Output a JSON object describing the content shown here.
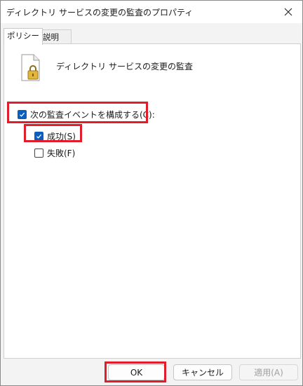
{
  "window": {
    "title": "ディレクトリ サービスの変更の監査のプロパティ",
    "close_icon": "close-icon"
  },
  "tabs": [
    {
      "label": "ポリシー",
      "active": true
    },
    {
      "label": "説明",
      "active": false
    }
  ],
  "policy": {
    "icon": "document-lock-icon",
    "name": "ディレクトリ サービスの変更の監査"
  },
  "options": {
    "configure": {
      "label": "次の監査イベントを構成する(C):",
      "checked": true
    },
    "success": {
      "label": "成功(S)",
      "checked": true
    },
    "failure": {
      "label": "失敗(F)",
      "checked": false
    }
  },
  "buttons": {
    "ok": "OK",
    "cancel": "キャンセル",
    "apply": "適用(A)"
  },
  "colors": {
    "accent": "#0a5ec0",
    "highlight": "#e01e2b"
  }
}
